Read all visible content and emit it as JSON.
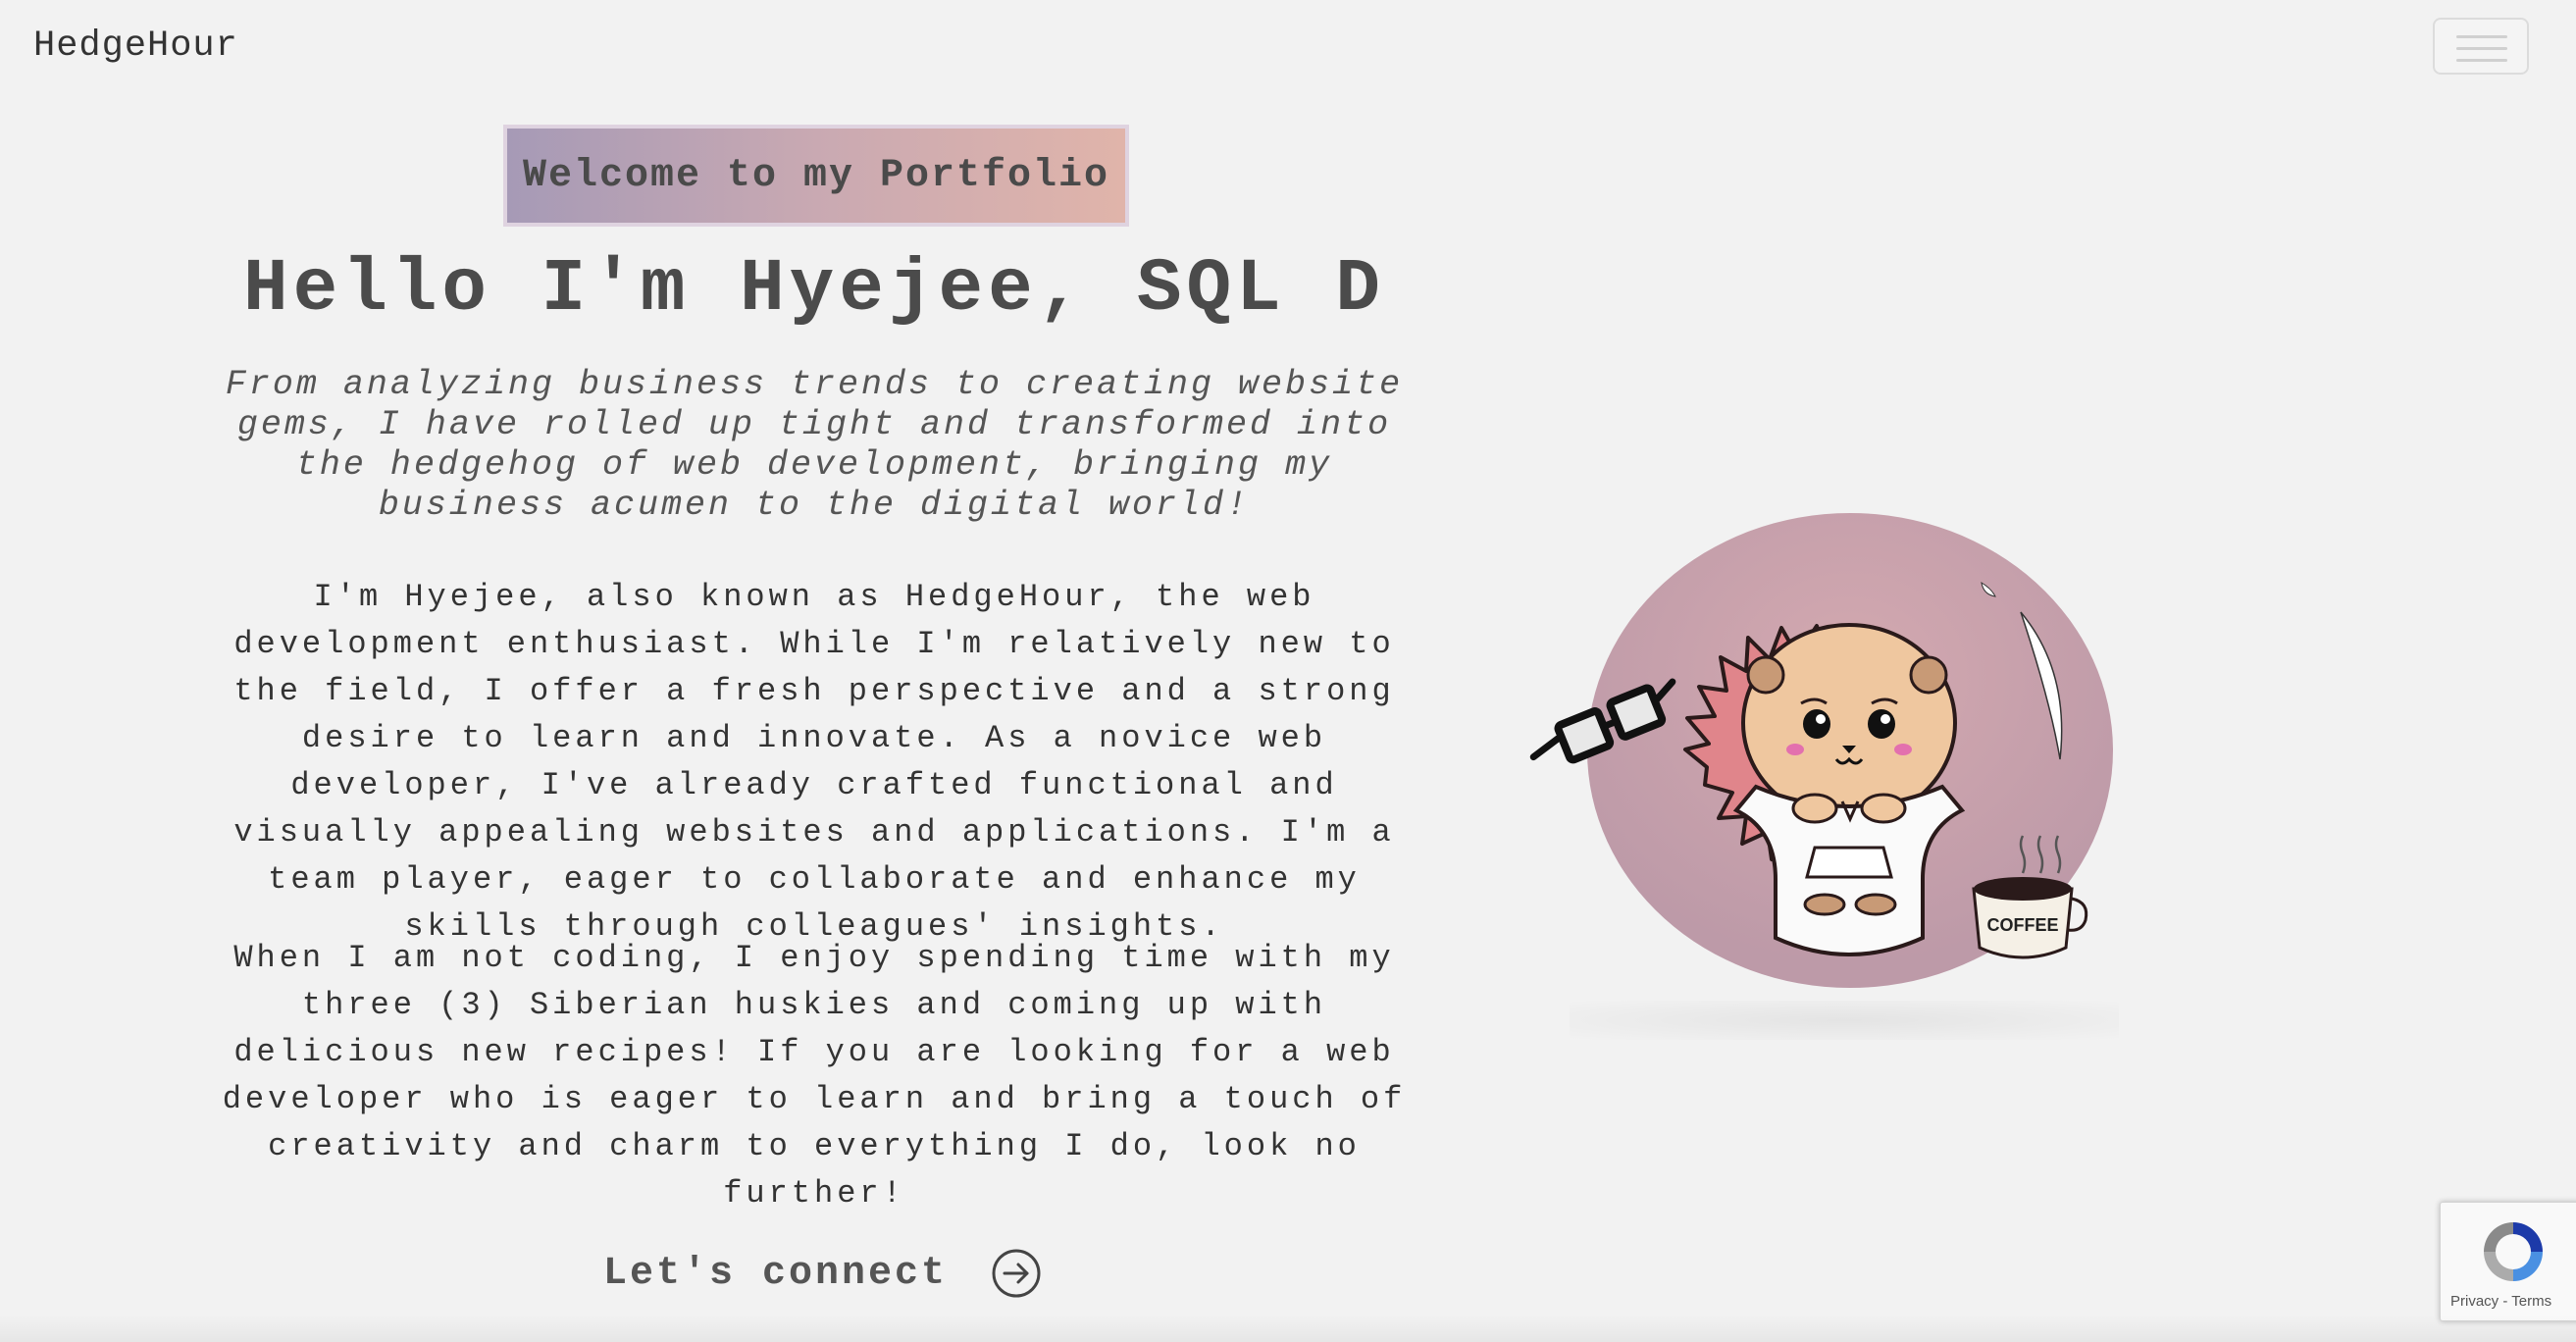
{
  "navbar": {
    "brand": "HedgeHour",
    "menu_icon": "hamburger-icon"
  },
  "hero": {
    "badge": "Welcome to my Portfolio",
    "heading": "Hello I'm Hyejee, SQL D",
    "tagline": "From analyzing business trends to creating website gems, I have rolled up tight and transformed into the hedgehog of web development, bringing my business acumen to the digital world!",
    "bio_paragraph_1": "I'm Hyejee, also known as HedgeHour, the web development enthusiast. While I'm relatively new to the field, I offer a fresh perspective and a strong desire to learn and innovate. As a novice web developer, I've already crafted functional and visually appealing websites and applications. I'm a team player, eager to collaborate and enhance my skills through colleagues' insights.",
    "bio_paragraph_2": "When I am not coding, I enjoy spending time with my three (3) Siberian huskies and coming up with delicious new recipes! If you are looking for a web developer who is eager to learn and bring a touch of creativity and charm to everything I do, look no further!",
    "cta_label": "Let's connect",
    "cta_icon": "arrow-right-circle-icon",
    "illustration_mug_text": "COFFEE"
  },
  "recaptcha": {
    "privacy": "Privacy",
    "separator": " - ",
    "terms": "Terms"
  },
  "colors": {
    "background": "#f2f2f2",
    "badge_gradient_start": "#a69ab6",
    "badge_gradient_end": "#e0b4aa",
    "illustration_circle": "#c3a0ad",
    "hedgehog_spikes": "#d9707a"
  }
}
